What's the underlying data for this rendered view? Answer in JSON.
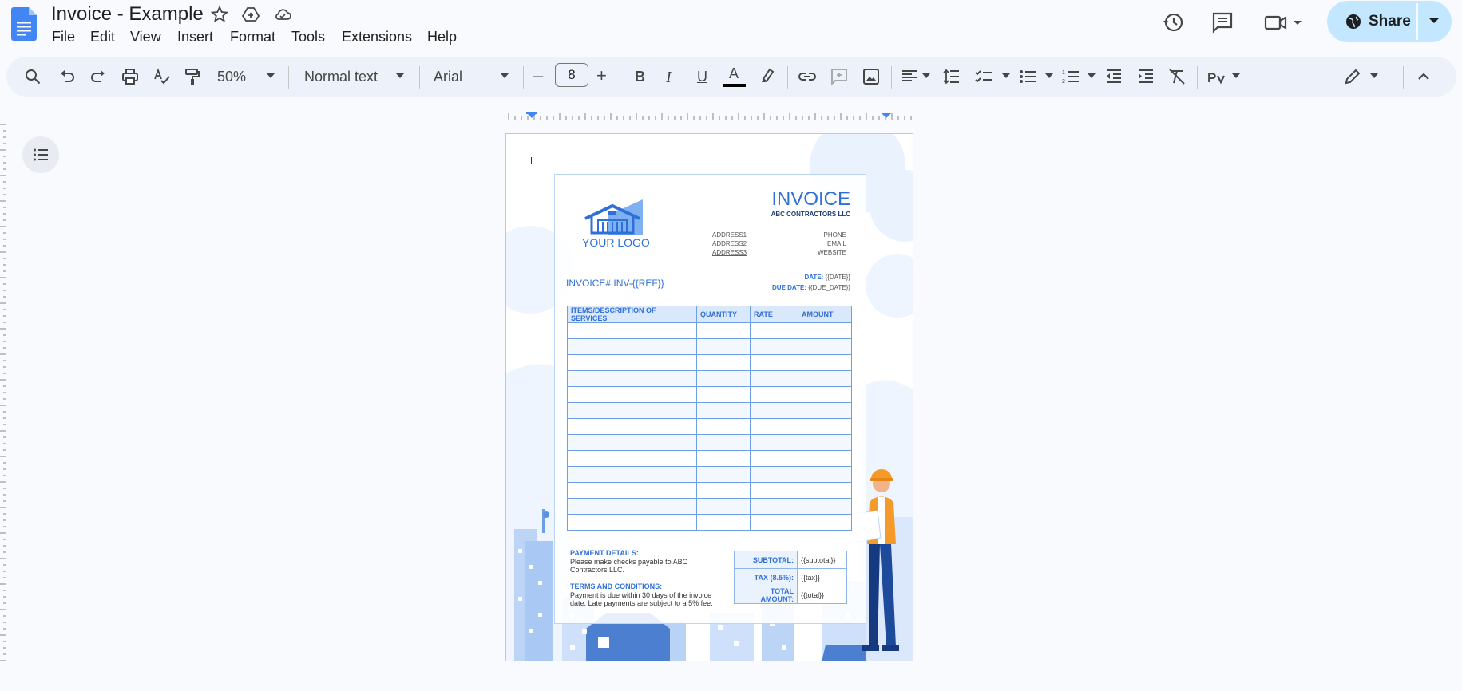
{
  "app": {
    "title": "Invoice - Example",
    "menus": [
      "File",
      "Edit",
      "View",
      "Insert",
      "Format",
      "Tools",
      "Extensions",
      "Help"
    ],
    "share_label": "Share"
  },
  "toolbar": {
    "zoom": "50%",
    "style": "Normal text",
    "font": "Arial",
    "font_size": "8",
    "minus": "–",
    "plus": "+",
    "bold": "B",
    "italic": "I",
    "underline": "U",
    "text_color": "A",
    "text_color_value": "#000000"
  },
  "invoice": {
    "logo_text": "YOUR LOGO",
    "heading": "INVOICE",
    "company": "ABC CONTRACTORS LLC",
    "address": [
      "ADDRESS1",
      "ADDRESS2",
      "ADDRESS3"
    ],
    "contact": [
      "PHONE",
      "EMAIL",
      "WEBSITE"
    ],
    "number_label": "INVOICE#",
    "number_value": "INV-{{REF}}",
    "date_label": "DATE:",
    "date_value": "{{DATE}}",
    "due_label": "DUE DATE:",
    "due_value": "{{DUE_DATE}}",
    "columns": [
      "ITEMS/DESCRIPTION OF SERVICES",
      "QUANTITY",
      "RATE",
      "AMOUNT"
    ],
    "payment_title": "PAYMENT DETAILS:",
    "payment_text": "Please make checks payable to ABC Contractors LLC.",
    "terms_title": "TERMS AND CONDITIONS:",
    "terms_text": "Payment is due within 30 days of the invoice date. Late payments are subject to a 5% fee.",
    "subtotal_label": "SUBTOTAL:",
    "subtotal_value": "{{subtotal}}",
    "tax_label": "TAX (8.5%):",
    "tax_value": "{{tax}}",
    "total_label": "TOTAL AMOUNT:",
    "total_value": "{{total}}"
  },
  "colors": {
    "accent": "#2f6fd8",
    "share_bg": "#c2e7ff",
    "toolbar_bg": "#edf2fa",
    "app_bg": "#f8fafd"
  }
}
